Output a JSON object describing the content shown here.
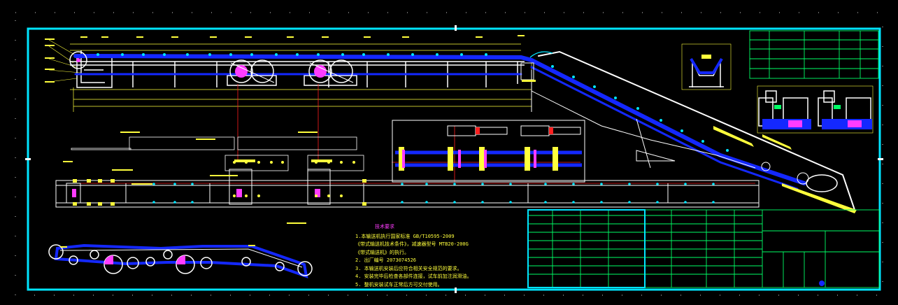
{
  "drawing": {
    "sheet_border_color": "#00ffff",
    "belt_color": "#1428ff",
    "frame_color": "#ffffff",
    "dimension_color": "#ffff3c",
    "section_color": "#ff2020",
    "table_color": "#00ff66"
  },
  "notes": {
    "title": "技术要求",
    "lines": [
      "1.本输送机执行国家标准 GB/T10595-2009",
      "《带式输送机技术条件》，减速器型号 MTB20-200G",
      "《带式输送机》的执行。",
      "2. 出厂编号 2073074526",
      "3. 本输送机安装后应符合相关安全规范的要求。",
      "4. 安装完毕后检查各部件连接，试车前加注润滑油。",
      "5. 整机安装试车正常后方可交付使用。"
    ]
  },
  "icons": {
    "drive": "drive-pulley-icon",
    "tail": "tail-pulley-icon",
    "idler": "idler-icon"
  }
}
